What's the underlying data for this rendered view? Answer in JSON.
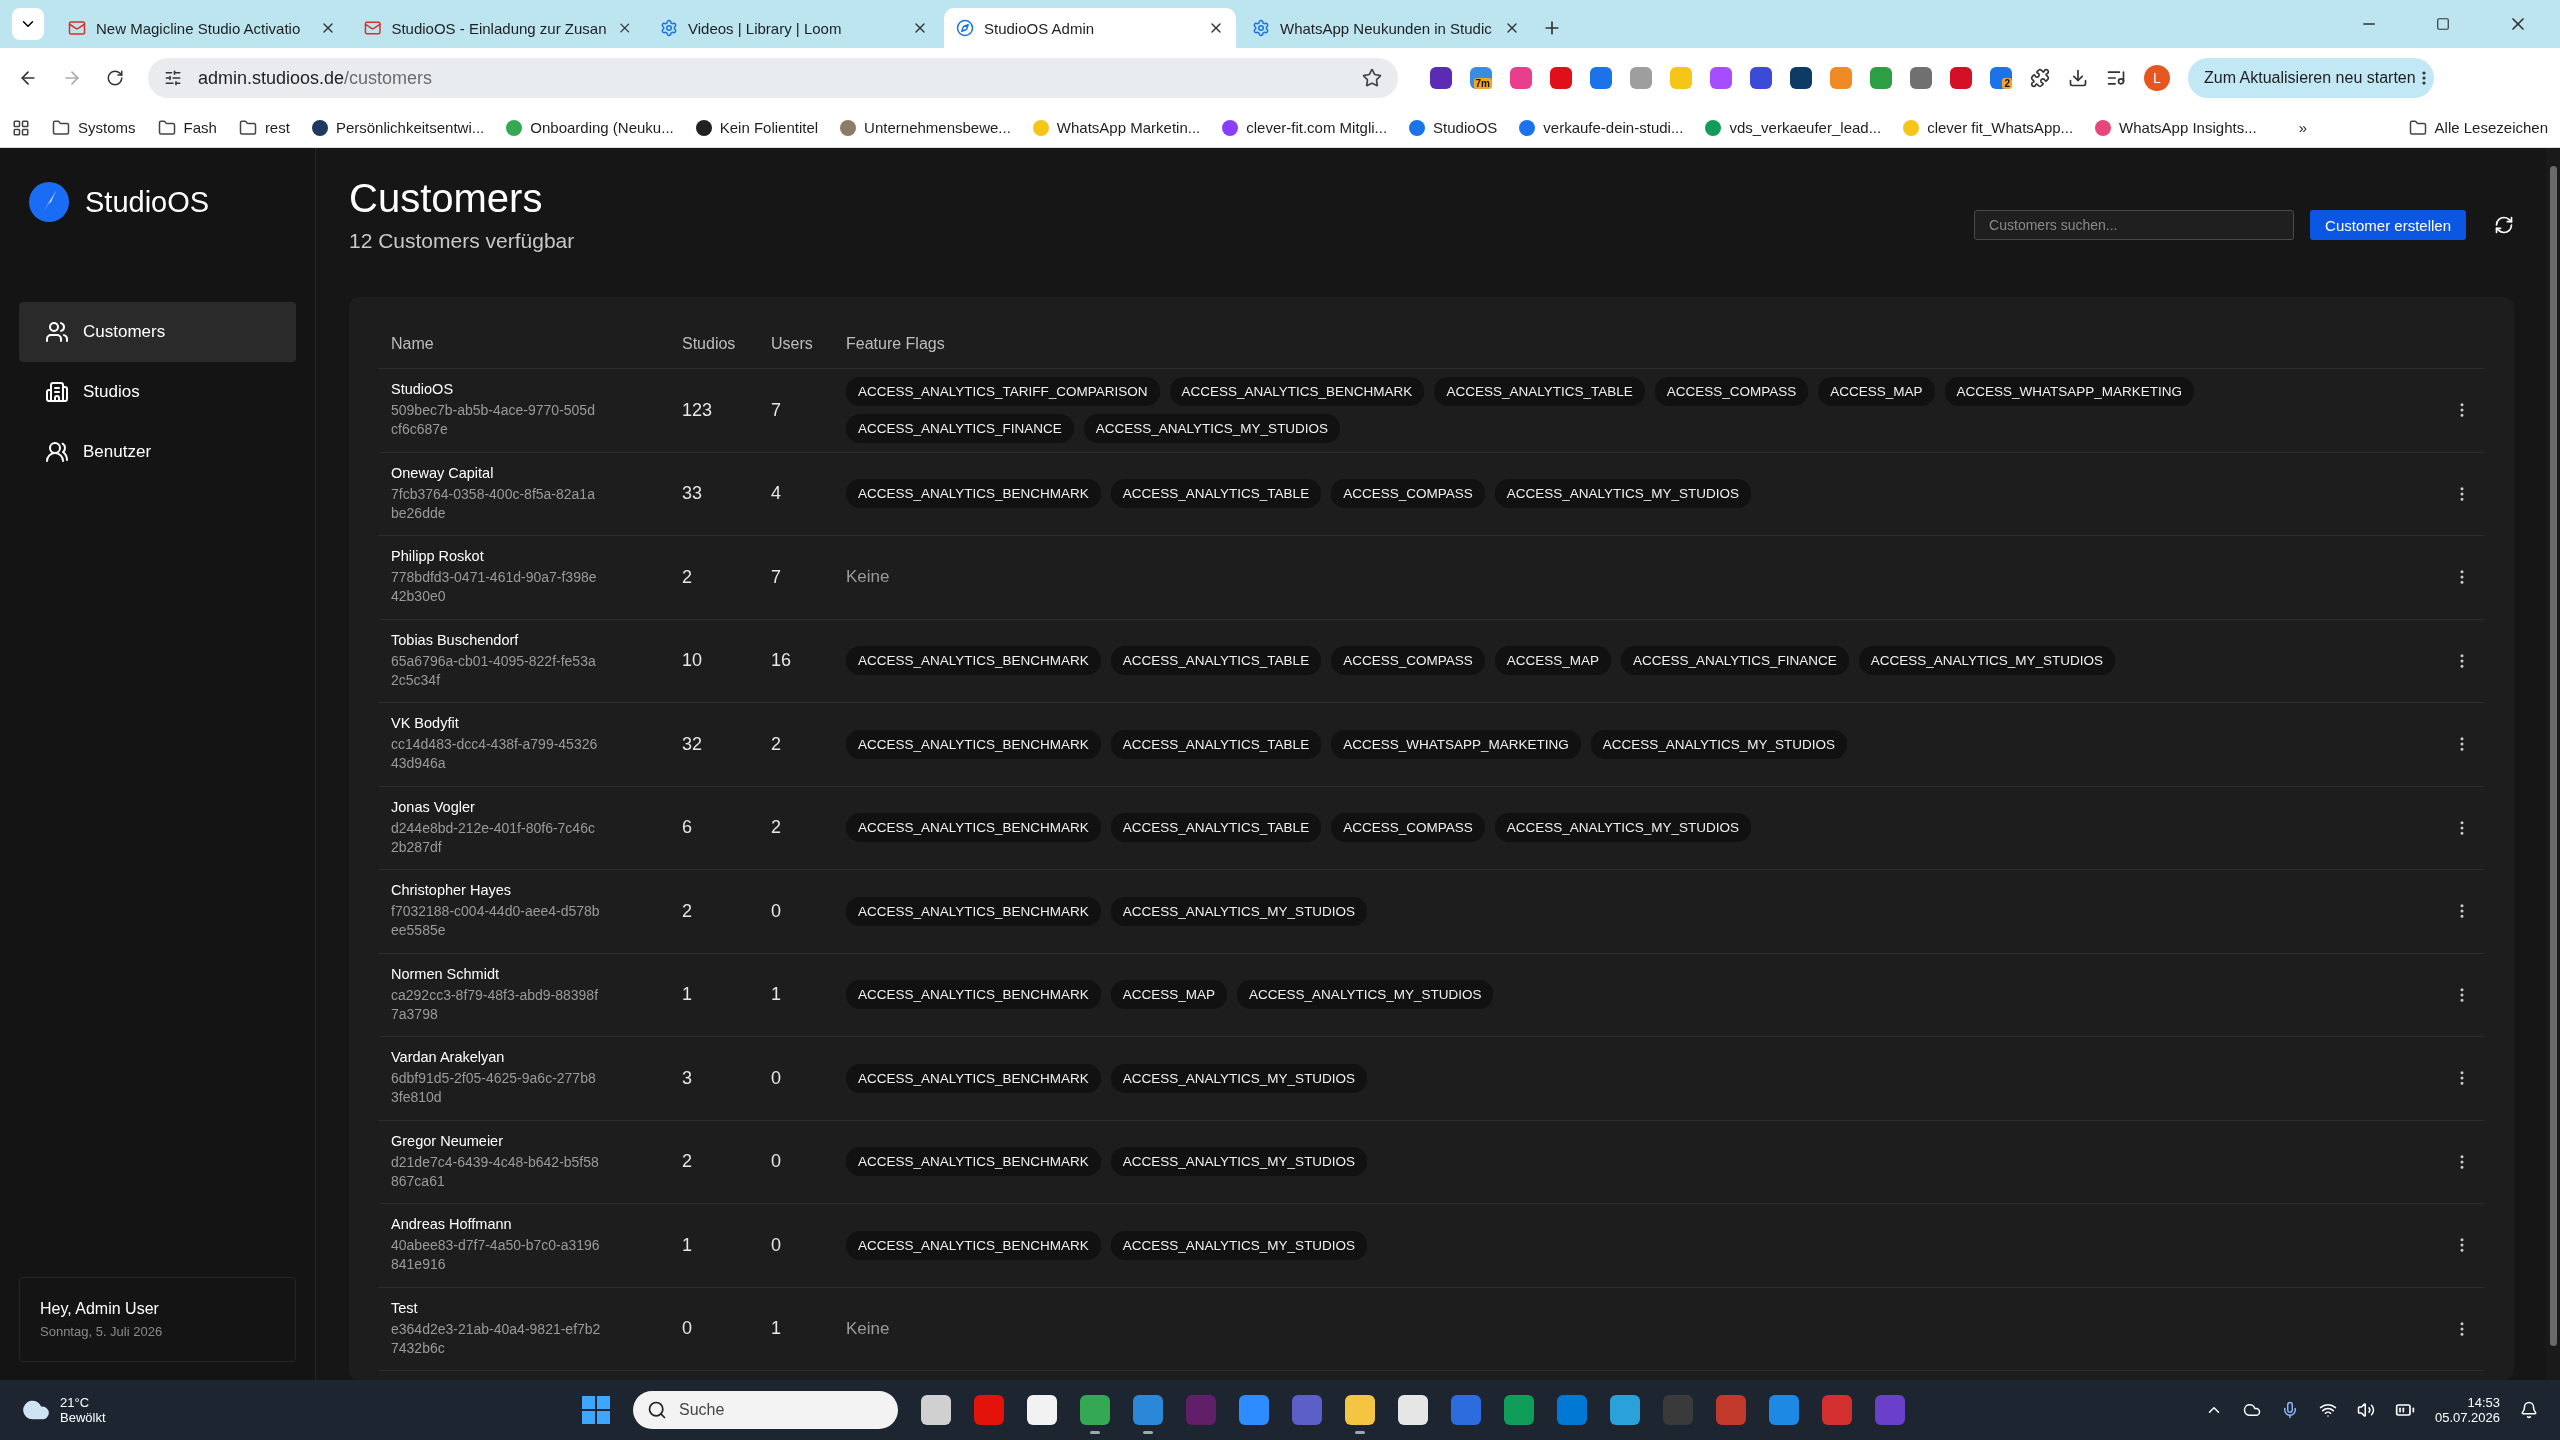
{
  "browser": {
    "tabs": [
      {
        "title": "New Magicline Studio Activatio",
        "kind": "mail",
        "selected": false
      },
      {
        "title": "StudioOS - Einladung zur Zusan",
        "kind": "mail",
        "selected": false
      },
      {
        "title": "Videos | Library | Loom",
        "kind": "gear",
        "selected": false
      },
      {
        "title": "StudioOS Admin",
        "kind": "compass",
        "selected": true
      },
      {
        "title": "WhatsApp Neukunden in Studic",
        "kind": "gear",
        "selected": false
      }
    ],
    "url_host": "admin.studioos.de",
    "url_path": "/customers",
    "extensions": [
      {
        "color": "#5b2bb5"
      },
      {
        "color": "#3a8dde",
        "badge": "7m"
      },
      {
        "color": "#e83e8c"
      },
      {
        "color": "#e0101a"
      },
      {
        "color": "#1a73e8"
      },
      {
        "color": "#9e9e9e"
      },
      {
        "color": "#f5c518"
      },
      {
        "color": "#a64dff"
      },
      {
        "color": "#3b4bd8"
      },
      {
        "color": "#0d3b66"
      },
      {
        "color": "#f08a24"
      },
      {
        "color": "#2e9e44"
      },
      {
        "color": "#707070"
      },
      {
        "color": "#d50f25"
      },
      {
        "color": "#1a73e8",
        "badge": "2"
      }
    ],
    "profile": "L",
    "update_button": "Zum Aktualisieren neu starten",
    "bookmarks": [
      {
        "label": "Systoms",
        "kind": "folder"
      },
      {
        "label": "Fash",
        "kind": "folder"
      },
      {
        "label": "rest",
        "kind": "folder"
      },
      {
        "label": "Persönlichkeitsentwi...",
        "kind": "site",
        "color": "#1f3a5f"
      },
      {
        "label": "Onboarding (Neuku...",
        "kind": "site",
        "color": "#34a853"
      },
      {
        "label": "Kein Folientitel",
        "kind": "site",
        "color": "#202124"
      },
      {
        "label": "Unternehmensbewe...",
        "kind": "site",
        "color": "#8d7b68"
      },
      {
        "label": "WhatsApp Marketin...",
        "kind": "site",
        "color": "#f5c518"
      },
      {
        "label": "clever-fit.com Mitgli...",
        "kind": "site",
        "color": "#8a3ffc"
      },
      {
        "label": "StudioOS",
        "kind": "site",
        "color": "#1a73e8"
      },
      {
        "label": "verkaufe-dein-studi...",
        "kind": "site",
        "color": "#1a73e8"
      },
      {
        "label": "vds_verkaeufer_lead...",
        "kind": "site",
        "color": "#0f9d58"
      },
      {
        "label": "clever fit_WhatsApp...",
        "kind": "site",
        "color": "#f5c518"
      },
      {
        "label": "WhatsApp Insights...",
        "kind": "site",
        "color": "#e8457c"
      }
    ],
    "more_bookmarks": "»",
    "all_bookmarks": "Alle Lesezeichen"
  },
  "app": {
    "brand": "StudioOS",
    "nav": [
      {
        "label": "Customers",
        "kind": "users",
        "selected": true
      },
      {
        "label": "Studios",
        "kind": "building",
        "selected": false
      },
      {
        "label": "Benutzer",
        "kind": "group",
        "selected": false
      }
    ],
    "user_greeting": "Hey, Admin User",
    "user_date": "Sonntag, 5. Juli 2026",
    "title": "Customers",
    "subtitle": "12 Customers verfügbar",
    "search": {
      "placeholder": "Customers suchen..."
    },
    "create_button": "Customer erstellen",
    "table": {
      "columns": [
        "Name",
        "Studios",
        "Users",
        "Feature Flags"
      ],
      "rows": [
        {
          "name": "StudioOS",
          "id": "509bec7b-ab5b-4ace-9770-505dcf6c687e",
          "studios": "123",
          "users": "7",
          "flags": [
            "ACCESS_ANALYTICS_TARIFF_COMPARISON",
            "ACCESS_ANALYTICS_BENCHMARK",
            "ACCESS_ANALYTICS_TABLE",
            "ACCESS_COMPASS",
            "ACCESS_MAP",
            "ACCESS_WHATSAPP_MARKETING",
            "ACCESS_ANALYTICS_FINANCE",
            "ACCESS_ANALYTICS_MY_STUDIOS"
          ]
        },
        {
          "name": "Oneway Capital",
          "id": "7fcb3764-0358-400c-8f5a-82a1abe26dde",
          "studios": "33",
          "users": "4",
          "flags": [
            "ACCESS_ANALYTICS_BENCHMARK",
            "ACCESS_ANALYTICS_TABLE",
            "ACCESS_COMPASS",
            "ACCESS_ANALYTICS_MY_STUDIOS"
          ]
        },
        {
          "name": "Philipp Roskot",
          "id": "778bdfd3-0471-461d-90a7-f398e42b30e0",
          "studios": "2",
          "users": "7",
          "no_flags": "Keine"
        },
        {
          "name": "Tobias Buschendorf",
          "id": "65a6796a-cb01-4095-822f-fe53a2c5c34f",
          "studios": "10",
          "users": "16",
          "flags": [
            "ACCESS_ANALYTICS_BENCHMARK",
            "ACCESS_ANALYTICS_TABLE",
            "ACCESS_COMPASS",
            "ACCESS_MAP",
            "ACCESS_ANALYTICS_FINANCE",
            "ACCESS_ANALYTICS_MY_STUDIOS"
          ]
        },
        {
          "name": "VK Bodyfit",
          "id": "cc14d483-dcc4-438f-a799-4532643d946a",
          "studios": "32",
          "users": "2",
          "flags": [
            "ACCESS_ANALYTICS_BENCHMARK",
            "ACCESS_ANALYTICS_TABLE",
            "ACCESS_WHATSAPP_MARKETING",
            "ACCESS_ANALYTICS_MY_STUDIOS"
          ]
        },
        {
          "name": "Jonas Vogler",
          "id": "d244e8bd-212e-401f-80f6-7c46c2b287df",
          "studios": "6",
          "users": "2",
          "flags": [
            "ACCESS_ANALYTICS_BENCHMARK",
            "ACCESS_ANALYTICS_TABLE",
            "ACCESS_COMPASS",
            "ACCESS_ANALYTICS_MY_STUDIOS"
          ]
        },
        {
          "name": "Christopher Hayes",
          "id": "f7032188-c004-44d0-aee4-d578bee5585e",
          "studios": "2",
          "users": "0",
          "flags": [
            "ACCESS_ANALYTICS_BENCHMARK",
            "ACCESS_ANALYTICS_MY_STUDIOS"
          ]
        },
        {
          "name": "Normen Schmidt",
          "id": "ca292cc3-8f79-48f3-abd9-88398f7a3798",
          "studios": "1",
          "users": "1",
          "flags": [
            "ACCESS_ANALYTICS_BENCHMARK",
            "ACCESS_MAP",
            "ACCESS_ANALYTICS_MY_STUDIOS"
          ]
        },
        {
          "name": "Vardan Arakelyan",
          "id": "6dbf91d5-2f05-4625-9a6c-277b83fe810d",
          "studios": "3",
          "users": "0",
          "flags": [
            "ACCESS_ANALYTICS_BENCHMARK",
            "ACCESS_ANALYTICS_MY_STUDIOS"
          ]
        },
        {
          "name": "Gregor Neumeier",
          "id": "d21de7c4-6439-4c48-b642-b5f58867ca61",
          "studios": "2",
          "users": "0",
          "flags": [
            "ACCESS_ANALYTICS_BENCHMARK",
            "ACCESS_ANALYTICS_MY_STUDIOS"
          ]
        },
        {
          "name": "Andreas Hoffmann",
          "id": "40abee83-d7f7-4a50-b7c0-a3196841e916",
          "studios": "1",
          "users": "0",
          "flags": [
            "ACCESS_ANALYTICS_BENCHMARK",
            "ACCESS_ANALYTICS_MY_STUDIOS"
          ]
        },
        {
          "name": "Test",
          "id": "e364d2e3-21ab-40a4-9821-ef7b27432b6c",
          "studios": "0",
          "users": "1",
          "no_flags": "Keine"
        }
      ]
    }
  },
  "taskbar": {
    "temperature": "21°C",
    "weather": "Bewölkt",
    "search_placeholder": "Suche",
    "apps": [
      {
        "color": "#d0d0d0",
        "running": false
      },
      {
        "color": "#e3120b",
        "running": false
      },
      {
        "color": "#f2f2f2",
        "running": false
      },
      {
        "color": "#34a853",
        "running": true
      },
      {
        "color": "#2b88d8",
        "running": true
      },
      {
        "color": "#611f69",
        "running": false
      },
      {
        "color": "#2d8cff",
        "running": false
      },
      {
        "color": "#5b5fc7",
        "running": false
      },
      {
        "color": "#f4c542",
        "running": true
      },
      {
        "color": "#e6e6e6",
        "running": false
      },
      {
        "color": "#2d6cdf",
        "running": false
      },
      {
        "color": "#0f9d58",
        "running": false
      },
      {
        "color": "#0078d4",
        "running": false
      },
      {
        "color": "#2aa1da",
        "running": false
      },
      {
        "color": "#3a3a3a",
        "running": false
      },
      {
        "color": "#c0392b",
        "running": false
      },
      {
        "color": "#1e88e5",
        "running": false
      },
      {
        "color": "#d32f2f",
        "running": false
      },
      {
        "color": "#6a3fc9",
        "running": false
      }
    ],
    "time": "14:53",
    "date": "05.07.2026"
  }
}
